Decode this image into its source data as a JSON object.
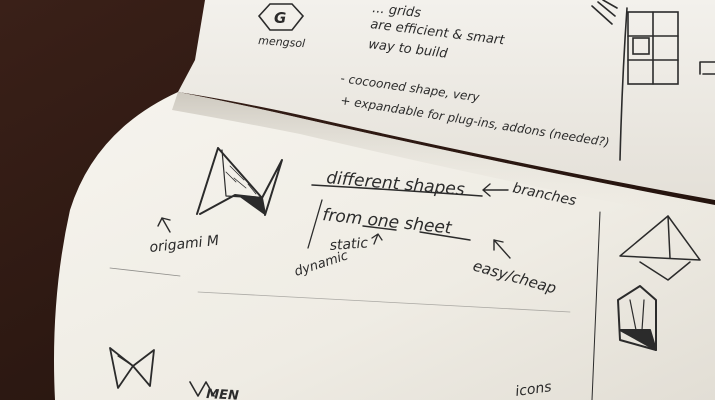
{
  "photo": {
    "subject": "open sketchbook with pen drawings of an origami M logo",
    "colors": {
      "desk": "#2a1712",
      "paper": "#f4f1ea",
      "ink": "#2b2b2b"
    }
  },
  "notes": {
    "top_page": {
      "logo_label": "mengsol",
      "line1": "... grids",
      "line2": "are efficient & smart",
      "line3": "way to build",
      "bullet_minus": "- cocooned shape, very",
      "bullet_plus": "+ expandable for plug-ins, addons (needed?)"
    },
    "bottom_page": {
      "line1": "different shapes",
      "line2": "from one sheet",
      "branches": "branches",
      "static": "static",
      "dynamic": "dynamic",
      "easy_cheap": "easy/cheap",
      "origami_m": "origami M",
      "icons": "icons",
      "bottom_logo": "MEN"
    }
  }
}
